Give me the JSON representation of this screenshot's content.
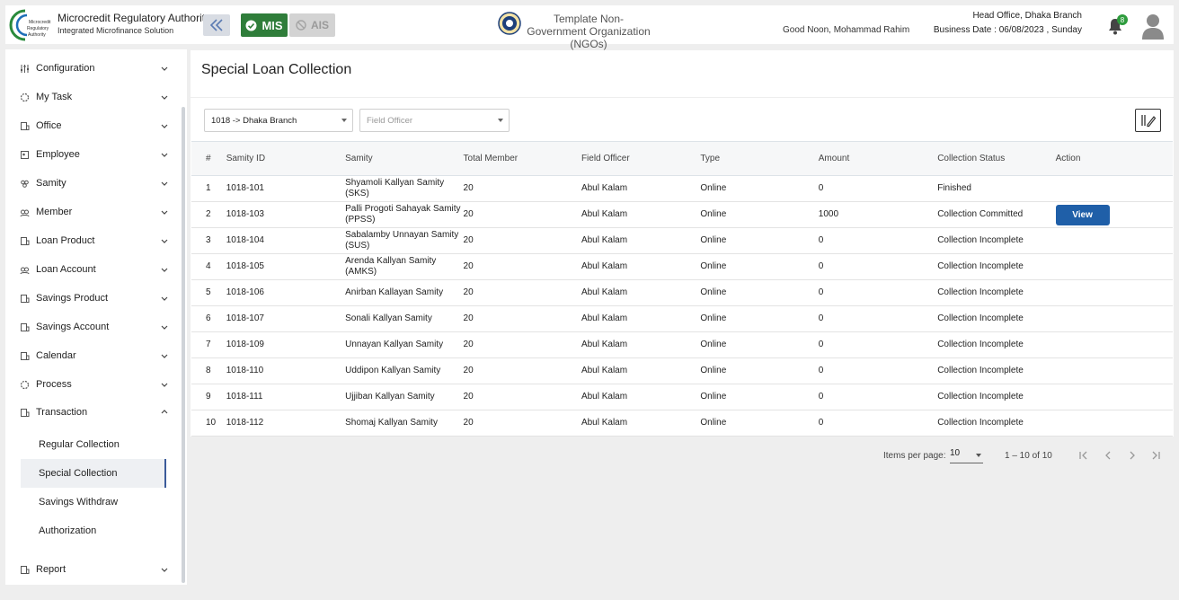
{
  "header": {
    "brand_title": "Microcredit Regulatory Authority",
    "brand_sub": "Integrated Microfinance Solution",
    "logo_text": [
      "Microcredit",
      "Regulatory",
      "Authority"
    ],
    "mis_label": "MIS",
    "ais_label": "AIS",
    "org_name": "Template Non-Government Organization (NGOs)",
    "greeting": "Good Noon, Mohammad Rahim",
    "branch": "Head Office, Dhaka Branch",
    "business_date": "Business Date : 06/08/2023 , Sunday",
    "notifications": "8",
    "colors": {
      "mis": "#2f7d3a",
      "badge": "#2e9c3d",
      "primary": "#1f5fa8"
    }
  },
  "sidebar": {
    "items": [
      {
        "label": "Configuration",
        "icon": "sliders-icon"
      },
      {
        "label": "My Task",
        "icon": "loader-icon"
      },
      {
        "label": "Office",
        "icon": "building-icon"
      },
      {
        "label": "Employee",
        "icon": "id-card-icon"
      },
      {
        "label": "Samity",
        "icon": "group-icon"
      },
      {
        "label": "Member",
        "icon": "users-icon"
      },
      {
        "label": "Loan Product",
        "icon": "building-icon"
      },
      {
        "label": "Loan Account",
        "icon": "users-icon"
      },
      {
        "label": "Savings Product",
        "icon": "building-icon"
      },
      {
        "label": "Savings Account",
        "icon": "building-icon"
      },
      {
        "label": "Calendar",
        "icon": "building-icon"
      },
      {
        "label": "Process",
        "icon": "loader-icon"
      },
      {
        "label": "Transaction",
        "icon": "building-icon"
      }
    ],
    "transaction_children": [
      "Regular Collection",
      "Special Collection",
      "Savings Withdraw",
      "Authorization"
    ],
    "report_label": "Report"
  },
  "main": {
    "title": "Special Loan Collection",
    "branch_select": "1018 -> Dhaka Branch",
    "officer_placeholder": "Field Officer",
    "columns": [
      "#",
      "Samity ID",
      "Samity",
      "Total Member",
      "Field Officer",
      "Type",
      "Amount",
      "Collection Status",
      "Action"
    ],
    "rows": [
      {
        "n": "1",
        "id": "1018-101",
        "samity": "Shyamoli Kallyan Samity (SKS)",
        "members": "20",
        "officer": "Abul Kalam",
        "type": "Online",
        "amount": "0",
        "status": "Finished",
        "action": ""
      },
      {
        "n": "2",
        "id": "1018-103",
        "samity": "Palli Progoti Sahayak Samity (PPSS)",
        "members": "20",
        "officer": "Abul Kalam",
        "type": "Online",
        "amount": "1000",
        "status": "Collection Committed",
        "action": "View"
      },
      {
        "n": "3",
        "id": "1018-104",
        "samity": "Sabalamby Unnayan Samity (SUS)",
        "members": "20",
        "officer": "Abul Kalam",
        "type": "Online",
        "amount": "0",
        "status": "Collection Incomplete",
        "action": ""
      },
      {
        "n": "4",
        "id": "1018-105",
        "samity": "Arenda Kallyan Samity (AMKS)",
        "members": "20",
        "officer": "Abul Kalam",
        "type": "Online",
        "amount": "0",
        "status": "Collection Incomplete",
        "action": ""
      },
      {
        "n": "5",
        "id": "1018-106",
        "samity": "Anirban Kallayan Samity",
        "members": "20",
        "officer": "Abul Kalam",
        "type": "Online",
        "amount": "0",
        "status": "Collection Incomplete",
        "action": ""
      },
      {
        "n": "6",
        "id": "1018-107",
        "samity": "Sonali Kallyan Samity",
        "members": "20",
        "officer": "Abul Kalam",
        "type": "Online",
        "amount": "0",
        "status": "Collection Incomplete",
        "action": ""
      },
      {
        "n": "7",
        "id": "1018-109",
        "samity": "Unnayan Kallyan Samity",
        "members": "20",
        "officer": "Abul Kalam",
        "type": "Online",
        "amount": "0",
        "status": "Collection Incomplete",
        "action": ""
      },
      {
        "n": "8",
        "id": "1018-110",
        "samity": "Uddipon Kallyan Samity",
        "members": "20",
        "officer": "Abul Kalam",
        "type": "Online",
        "amount": "0",
        "status": "Collection Incomplete",
        "action": ""
      },
      {
        "n": "9",
        "id": "1018-111",
        "samity": "Ujjiban Kallyan Samity",
        "members": "20",
        "officer": "Abul Kalam",
        "type": "Online",
        "amount": "0",
        "status": "Collection Incomplete",
        "action": ""
      },
      {
        "n": "10",
        "id": "1018-112",
        "samity": "Shomaj Kallyan Samity",
        "members": "20",
        "officer": "Abul Kalam",
        "type": "Online",
        "amount": "0",
        "status": "Collection Incomplete",
        "action": ""
      }
    ]
  },
  "paginator": {
    "items_label": "Items per page:",
    "page_size": "10",
    "range": "1 – 10 of 10"
  }
}
